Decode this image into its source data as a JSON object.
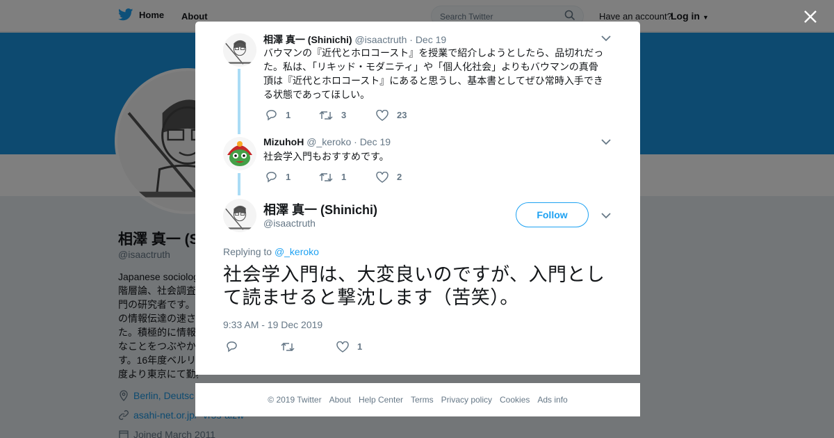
{
  "header": {
    "home_label": "Home",
    "about_label": "About",
    "search_placeholder": "Search Twitter",
    "have_account": "Have an account?",
    "login_label": "Log in"
  },
  "profile": {
    "name": "相澤 真一 (S",
    "handle": "@isaactruth",
    "bio_lines": [
      "Japanese sociolog",
      "階層論、社会調査",
      "門の研究者です。",
      "の情報伝達の速さ",
      "た。積極的に情報",
      "なことをつぶやか",
      "す。16年度ベルリ",
      "度より東京にて勤務。"
    ],
    "location": "Berlin, Deutsc",
    "url": "asahi-net.or.jp/~vr5s-aizw",
    "joined": "Joined March 2011"
  },
  "tweets": [
    {
      "name": "相澤 真一 (Shinichi)",
      "handle": "@isaactruth",
      "date": "· Dec 19",
      "text_lines": [
        "バウマンの『近代とホロコースト』を授業で紹介しようとしたら、品切れだっ",
        "た。私は、「リキッド・モダニティ」や「個人化社会」よりもバウマンの真骨",
        "頂は『近代とホロコースト』にあると思うし、基本書としてぜひ常時入手でき",
        "る状態であってほしい。"
      ],
      "replies": "1",
      "retweets": "3",
      "likes": "23"
    },
    {
      "name": "MizuhoH",
      "handle": "@_keroko",
      "date": "· Dec 19",
      "text_lines": [
        "社会学入門もおすすめです。"
      ],
      "replies": "1",
      "retweets": "1",
      "likes": "2"
    }
  ],
  "main_tweet": {
    "name": "相澤 真一 (Shinichi)",
    "handle": "@isaactruth",
    "follow_label": "Follow",
    "replying_prefix": "Replying to",
    "replying_to": "@_keroko",
    "text_lines": [
      "社会学入門は、大変良いのですが、入門とし",
      "て読ませると撃沈します（苦笑）。"
    ],
    "timestamp": "9:33 AM - 19 Dec 2019",
    "likes": "1"
  },
  "footer": {
    "links": [
      "© 2019 Twitter",
      "About",
      "Help Center",
      "Terms",
      "Privacy policy",
      "Cookies",
      "Ads info"
    ]
  },
  "colors": {
    "brand_blue": "#1da1f2",
    "banner": "#1b95e0",
    "thread_line": "#aadcf5",
    "muted_text": "#657786"
  },
  "icons": {
    "logo": "twitter-bird-icon",
    "close": "close-icon",
    "reply": "reply-icon",
    "retweet": "retweet-icon",
    "like": "heart-icon",
    "more": "chevron-down-icon"
  }
}
